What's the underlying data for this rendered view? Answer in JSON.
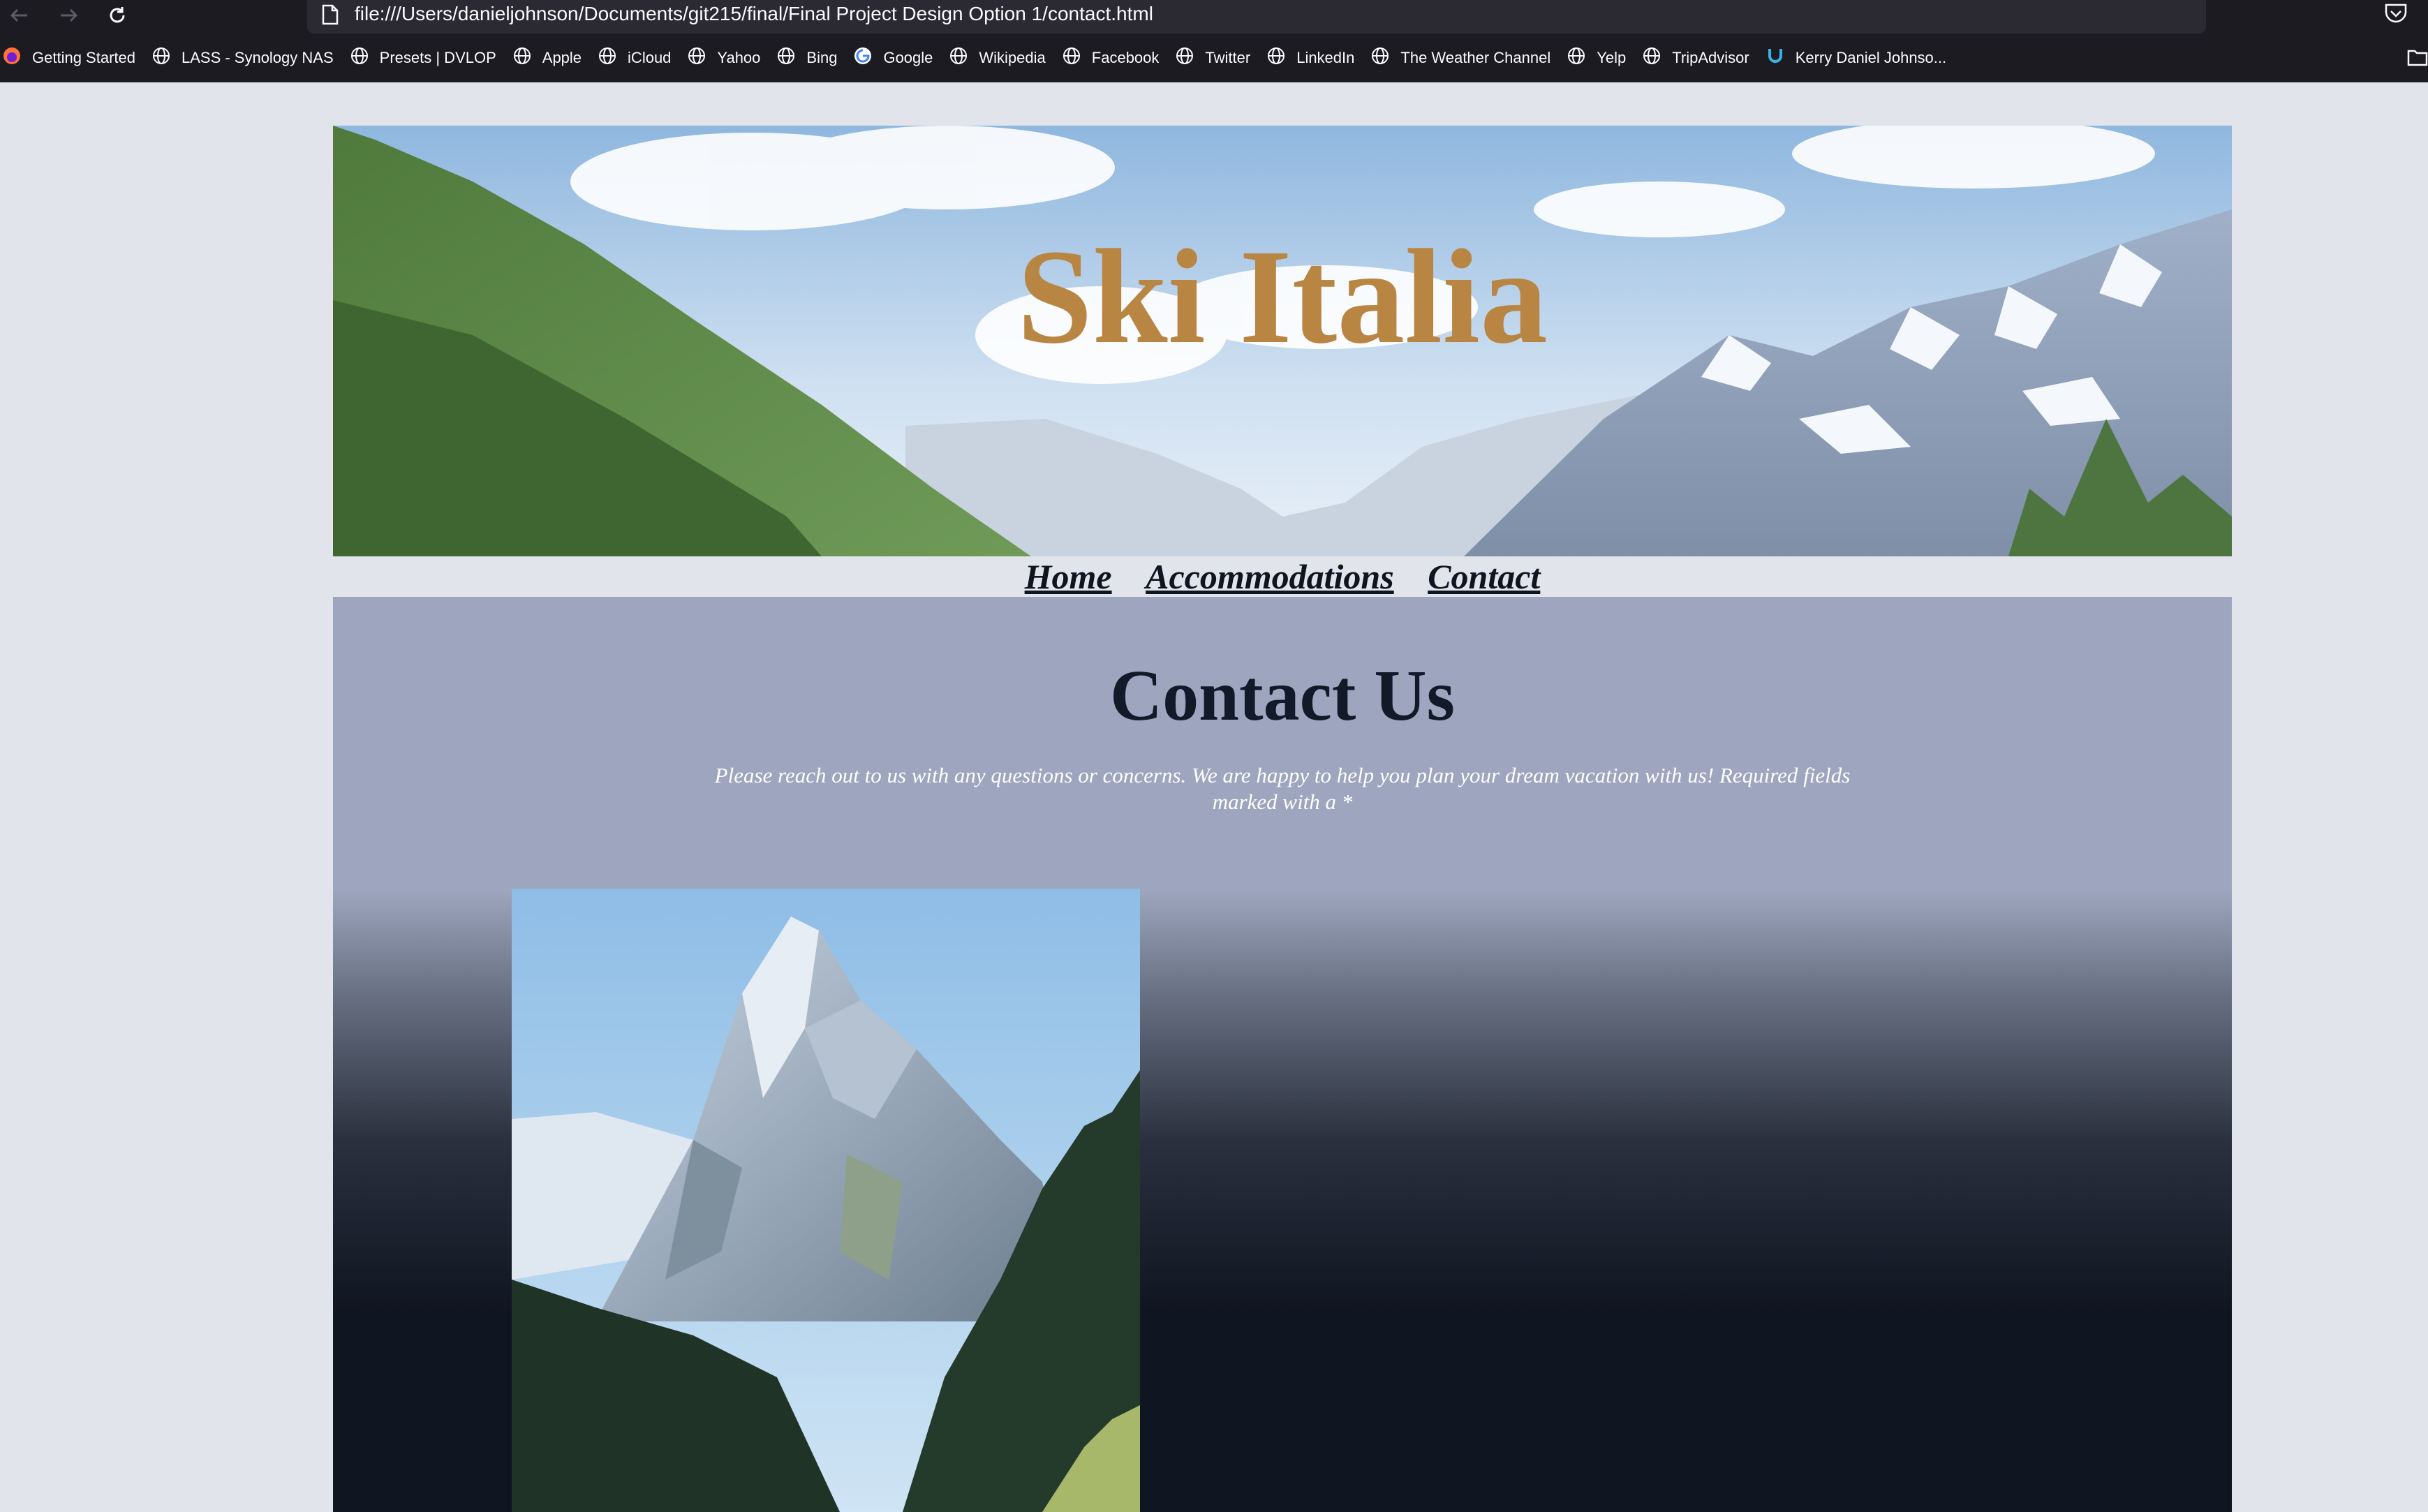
{
  "browser": {
    "url": "file:///Users/danieljohnson/Documents/git215/final/Final Project Design Option 1/contact.html",
    "bookmarks": [
      {
        "label": "Getting Started",
        "icon": "firefox-icon"
      },
      {
        "label": "LASS - Synology NAS",
        "icon": "globe-icon"
      },
      {
        "label": "Presets | DVLOP",
        "icon": "globe-icon"
      },
      {
        "label": "Apple",
        "icon": "globe-icon"
      },
      {
        "label": "iCloud",
        "icon": "globe-icon"
      },
      {
        "label": "Yahoo",
        "icon": "globe-icon"
      },
      {
        "label": "Bing",
        "icon": "globe-icon"
      },
      {
        "label": "Google",
        "icon": "google-icon"
      },
      {
        "label": "Wikipedia",
        "icon": "globe-icon"
      },
      {
        "label": "Facebook",
        "icon": "globe-icon"
      },
      {
        "label": "Twitter",
        "icon": "globe-icon"
      },
      {
        "label": "LinkedIn",
        "icon": "globe-icon"
      },
      {
        "label": "The Weather Channel",
        "icon": "globe-icon"
      },
      {
        "label": "Yelp",
        "icon": "globe-icon"
      },
      {
        "label": "TripAdvisor",
        "icon": "globe-icon"
      },
      {
        "label": "Kerry Daniel Johnso...",
        "icon": "magnet-icon"
      }
    ]
  },
  "site": {
    "title": "Ski Italia",
    "title_color": "#b98542",
    "nav": [
      "Home",
      "Accommodations",
      "Contact"
    ]
  },
  "contact": {
    "heading": "Contact Us",
    "intro": "Please reach out to us with any questions or concerns. We are happy to help you plan your dream vacation with us! Required fields marked with a *"
  },
  "colors": {
    "content_bg": "#9ea6bf",
    "content_dark": "#101522",
    "page_bg": "#e1e4ea",
    "heading": "#121a2a"
  }
}
